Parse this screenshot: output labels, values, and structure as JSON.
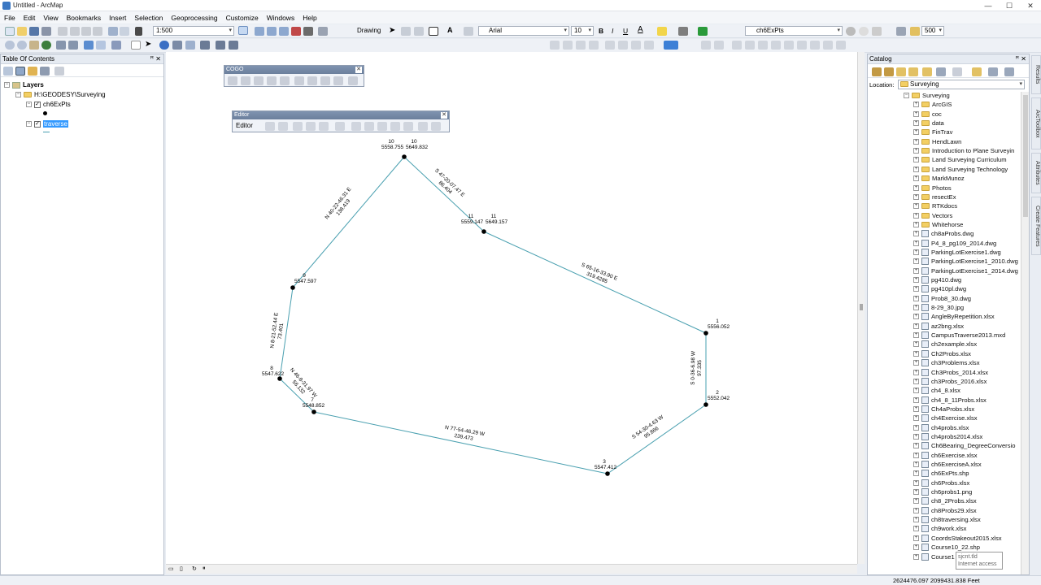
{
  "window": {
    "title": "Untitled - ArcMap"
  },
  "menu": [
    "File",
    "Edit",
    "View",
    "Bookmarks",
    "Insert",
    "Selection",
    "Geoprocessing",
    "Customize",
    "Windows",
    "Help"
  ],
  "toolbar": {
    "scale": "1:500",
    "drawing_label": "Drawing",
    "font_name": "Arial",
    "font_size": "10",
    "bold": "B",
    "italic": "I",
    "underline": "U",
    "layer_select": "ch6ExPts",
    "ref_scale": "500"
  },
  "toc": {
    "title": "Table Of Contents",
    "layers_label": "Layers",
    "source": "H:\\GEODESY\\Surveying",
    "layer1": "ch6ExPts",
    "layer2": "traverse"
  },
  "cogo": {
    "title": "COGO"
  },
  "editor": {
    "title": "Editor",
    "menu_label": "Editor"
  },
  "catalog": {
    "title": "Catalog",
    "location_label": "Location:",
    "location_value": "Surveying",
    "root": "Surveying",
    "folders": [
      "ArcGIS",
      "coc",
      "data",
      "FinTrav",
      "HendLawn",
      "Introduction to Plane Surveyin",
      "Land Surveying Curriculum",
      "Land Surveying Technology",
      "MarkMunoz",
      "Photos",
      "resectEx",
      "RTKdocs",
      "Vectors",
      "Whitehorse"
    ],
    "files": [
      "ch8aProbs.dwg",
      "P4_8_pg109_2014.dwg",
      "ParkingLotExercise1.dwg",
      "ParkingLotExercise1_2010.dwg",
      "ParkingLotExercise1_2014.dwg",
      "pg410.dwg",
      "pg410pl.dwg",
      "Prob8_30.dwg",
      "8-29_30.jpg",
      "AngleByRepetition.xlsx",
      "az2bng.xlsx",
      "CampusTraverse2013.mxd",
      "ch2example.xlsx",
      "Ch2Probs.xlsx",
      "ch3Problems.xlsx",
      "Ch3Probs_2014.xlsx",
      "ch3Probs_2016.xlsx",
      "ch4_8.xlsx",
      "ch4_8_11Probs.xlsx",
      "Ch4aProbs.xlsx",
      "ch4Exercise.xlsx",
      "ch4probs.xlsx",
      "ch4probs2014.xlsx",
      "Ch6Bearing_DegreeConversio",
      "ch6Exercise.xlsx",
      "ch6ExerciseA.xlsx",
      "ch6ExPts.shp",
      "ch6Probs.xlsx",
      "ch6probs1.png",
      "ch8_2Probs.xlsx",
      "ch8Probs29.xlsx",
      "ch8traversing.xlsx",
      "ch9work.xlsx",
      "CoordsStakeout2015.xlsx",
      "Course10_22.shp",
      "Course1"
    ]
  },
  "side_tabs": [
    "Results",
    "ArcToolbox",
    "Attributes",
    "Create Features"
  ],
  "tooltip": {
    "line1": "sjcnt.tld",
    "line2": "Internet access"
  },
  "status": {
    "coords": "2624476.097  2099431.838 Feet"
  },
  "map": {
    "points": [
      {
        "id": "10",
        "label_id": "10",
        "elev": "5558.755",
        "elev2": "5649.832",
        "alt_id": "10"
      },
      {
        "id": "11",
        "label_id": "11",
        "elev": "5559.147",
        "elev2": "5649.157",
        "alt_id": "11"
      },
      {
        "id": "1",
        "label_id": "1",
        "elev": "5556.052"
      },
      {
        "id": "2",
        "label_id": "2",
        "elev": "5552.042"
      },
      {
        "id": "3",
        "label_id": "3",
        "elev": "5547.412"
      },
      {
        "id": "7",
        "label_id": "7",
        "elev": "5548.852"
      },
      {
        "id": "8",
        "label_id": "8",
        "elev": "5547.622"
      },
      {
        "id": "9",
        "label_id": "9",
        "elev": "5547.597"
      }
    ],
    "courses": [
      {
        "bearing": "S 47-20-07.47 E",
        "dist": "86.404"
      },
      {
        "bearing": "S 65-16-33.90 E",
        "dist": "319.4285"
      },
      {
        "bearing": "S 0-36-6.98 W",
        "dist": "97.335"
      },
      {
        "bearing": "S 54-30-4.63 W",
        "dist": "95.866"
      },
      {
        "bearing": "N 77-54-46.29 W",
        "dist": "239.473"
      },
      {
        "bearing": "N 46-8-31.97 W",
        "dist": "56.132"
      },
      {
        "bearing": "N 8-21-52.44 E",
        "dist": "73.401"
      },
      {
        "bearing": "N 40-22-46.31 E",
        "dist": "138.419"
      }
    ]
  }
}
